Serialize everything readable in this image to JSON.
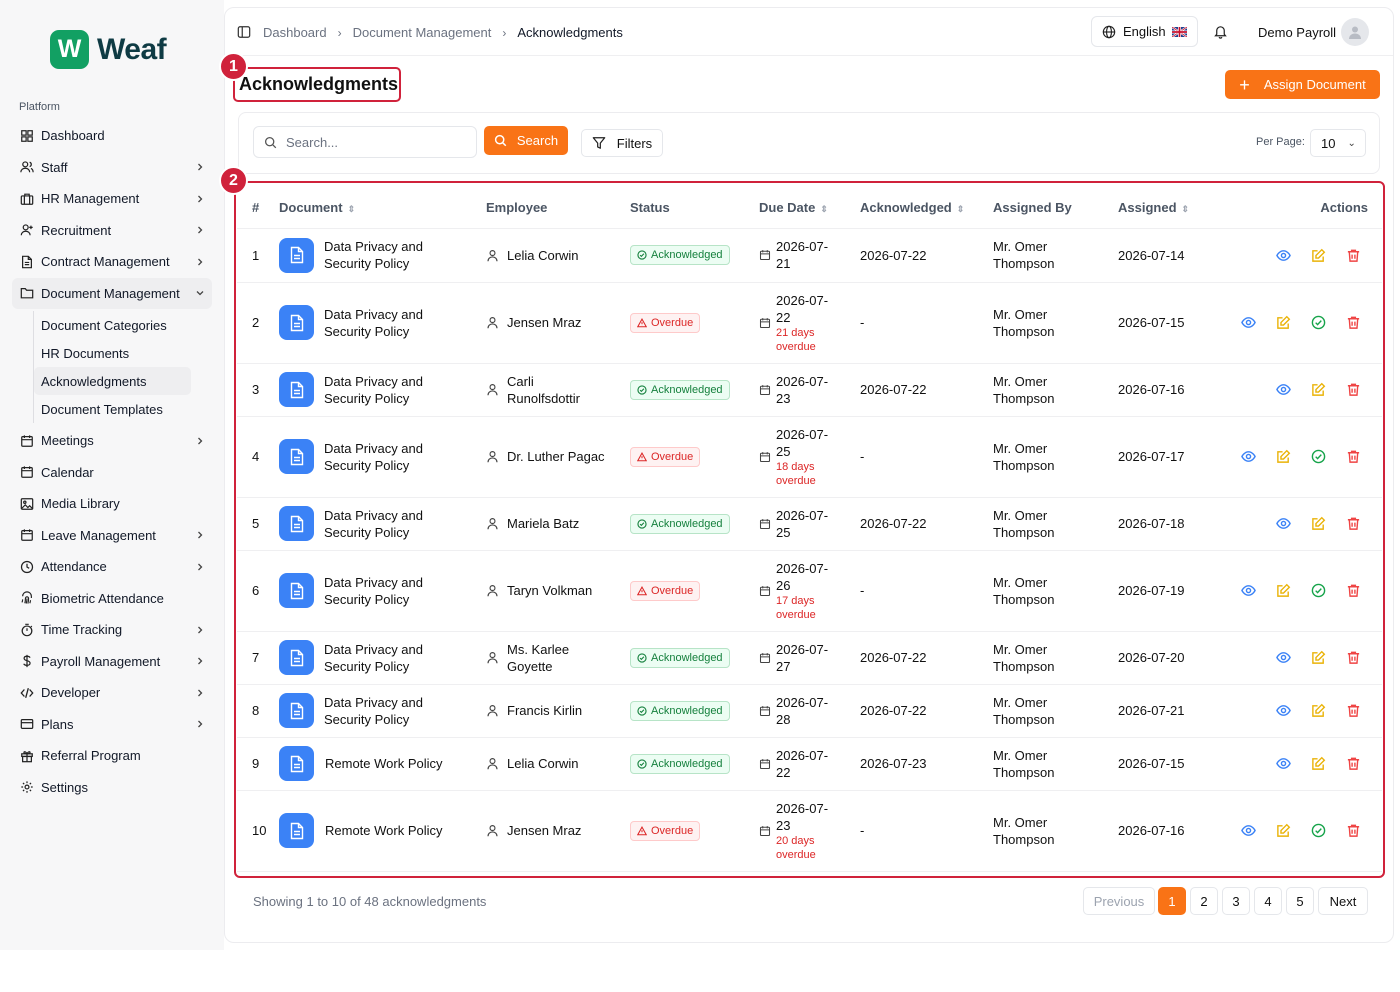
{
  "brand": {
    "mark": "W",
    "name": "Weaf"
  },
  "sidebar": {
    "section_label": "Platform",
    "items": [
      {
        "label": "Dashboard",
        "icon": "grid-icon",
        "chevron": false
      },
      {
        "label": "Staff",
        "icon": "users-icon",
        "chevron": true
      },
      {
        "label": "HR Management",
        "icon": "briefcase-icon",
        "chevron": true
      },
      {
        "label": "Recruitment",
        "icon": "user-plus-icon",
        "chevron": true
      },
      {
        "label": "Contract Management",
        "icon": "file-icon",
        "chevron": true
      },
      {
        "label": "Document Management",
        "icon": "folder-icon",
        "chevron": true,
        "open": true
      },
      {
        "label": "Meetings",
        "icon": "calendar-icon",
        "chevron": true
      },
      {
        "label": "Calendar",
        "icon": "calendar-icon",
        "chevron": false
      },
      {
        "label": "Media Library",
        "icon": "image-icon",
        "chevron": false
      },
      {
        "label": "Leave Management",
        "icon": "calendar-icon",
        "chevron": true
      },
      {
        "label": "Attendance",
        "icon": "clock-icon",
        "chevron": true
      },
      {
        "label": "Biometric Attendance",
        "icon": "fingerprint-icon",
        "chevron": false
      },
      {
        "label": "Time Tracking",
        "icon": "timer-icon",
        "chevron": true
      },
      {
        "label": "Payroll Management",
        "icon": "dollar-icon",
        "chevron": true
      },
      {
        "label": "Developer",
        "icon": "code-icon",
        "chevron": true
      },
      {
        "label": "Plans",
        "icon": "card-icon",
        "chevron": true
      },
      {
        "label": "Referral Program",
        "icon": "gift-icon",
        "chevron": false
      },
      {
        "label": "Settings",
        "icon": "gear-icon",
        "chevron": false
      }
    ],
    "subitems": [
      "Document Categories",
      "HR Documents",
      "Acknowledgments",
      "Document Templates"
    ]
  },
  "header": {
    "breadcrumbs": [
      "Dashboard",
      "Document Management",
      "Acknowledgments"
    ],
    "language": "English",
    "user": "Demo Payroll"
  },
  "page": {
    "title": "Acknowledgments",
    "assign_label": "Assign Document",
    "annotation_1": "1",
    "annotation_2": "2"
  },
  "filters": {
    "search_placeholder": "Search...",
    "search_label": "Search",
    "filters_label": "Filters",
    "per_page_label": "Per Page:",
    "per_page_value": "10"
  },
  "table": {
    "columns": [
      "#",
      "Document",
      "Employee",
      "Status",
      "Due Date",
      "Acknowledged",
      "Assigned By",
      "Assigned",
      "Actions"
    ],
    "rows": [
      {
        "num": "1",
        "document": "Data Privacy and Security Policy",
        "employee": "Lelia Corwin",
        "status": "Acknowledged",
        "due": "2026-07-21",
        "due_note": "",
        "acknowledged": "2026-07-22",
        "assigned_by": "Mr. Omer Thompson",
        "assigned": "2026-07-14"
      },
      {
        "num": "2",
        "document": "Data Privacy and Security Policy",
        "employee": "Jensen Mraz",
        "status": "Overdue",
        "due": "2026-07-22",
        "due_note": "21 days overdue",
        "acknowledged": "-",
        "assigned_by": "Mr. Omer Thompson",
        "assigned": "2026-07-15"
      },
      {
        "num": "3",
        "document": "Data Privacy and Security Policy",
        "employee": "Carli Runolfsdottir",
        "status": "Acknowledged",
        "due": "2026-07-23",
        "due_note": "",
        "acknowledged": "2026-07-22",
        "assigned_by": "Mr. Omer Thompson",
        "assigned": "2026-07-16"
      },
      {
        "num": "4",
        "document": "Data Privacy and Security Policy",
        "employee": "Dr. Luther Pagac",
        "status": "Overdue",
        "due": "2026-07-25",
        "due_note": "18 days overdue",
        "acknowledged": "-",
        "assigned_by": "Mr. Omer Thompson",
        "assigned": "2026-07-17"
      },
      {
        "num": "5",
        "document": "Data Privacy and Security Policy",
        "employee": "Mariela Batz",
        "status": "Acknowledged",
        "due": "2026-07-25",
        "due_note": "",
        "acknowledged": "2026-07-22",
        "assigned_by": "Mr. Omer Thompson",
        "assigned": "2026-07-18"
      },
      {
        "num": "6",
        "document": "Data Privacy and Security Policy",
        "employee": "Taryn Volkman",
        "status": "Overdue",
        "due": "2026-07-26",
        "due_note": "17 days overdue",
        "acknowledged": "-",
        "assigned_by": "Mr. Omer Thompson",
        "assigned": "2026-07-19"
      },
      {
        "num": "7",
        "document": "Data Privacy and Security Policy",
        "employee": "Ms. Karlee Goyette",
        "status": "Acknowledged",
        "due": "2026-07-27",
        "due_note": "",
        "acknowledged": "2026-07-22",
        "assigned_by": "Mr. Omer Thompson",
        "assigned": "2026-07-20"
      },
      {
        "num": "8",
        "document": "Data Privacy and Security Policy",
        "employee": "Francis Kirlin",
        "status": "Acknowledged",
        "due": "2026-07-28",
        "due_note": "",
        "acknowledged": "2026-07-22",
        "assigned_by": "Mr. Omer Thompson",
        "assigned": "2026-07-21"
      },
      {
        "num": "9",
        "document": "Remote Work Policy",
        "employee": "Lelia Corwin",
        "status": "Acknowledged",
        "due": "2026-07-22",
        "due_note": "",
        "acknowledged": "2026-07-23",
        "assigned_by": "Mr. Omer Thompson",
        "assigned": "2026-07-15"
      },
      {
        "num": "10",
        "document": "Remote Work Policy",
        "employee": "Jensen Mraz",
        "status": "Overdue",
        "due": "2026-07-23",
        "due_note": "20 days overdue",
        "acknowledged": "-",
        "assigned_by": "Mr. Omer Thompson",
        "assigned": "2026-07-16"
      }
    ]
  },
  "footer": {
    "showing": "Showing 1 to 10 of 48 acknowledgments",
    "previous": "Previous",
    "pages": [
      "1",
      "2",
      "3",
      "4",
      "5"
    ],
    "next": "Next"
  },
  "colors": {
    "accent": "#f97316",
    "brand_green": "#12a063",
    "doc_icon_blue": "#3b82f6",
    "acknowledged_green": "#15803d",
    "overdue_red": "#dc2626",
    "annotation_red": "#d0223b"
  }
}
